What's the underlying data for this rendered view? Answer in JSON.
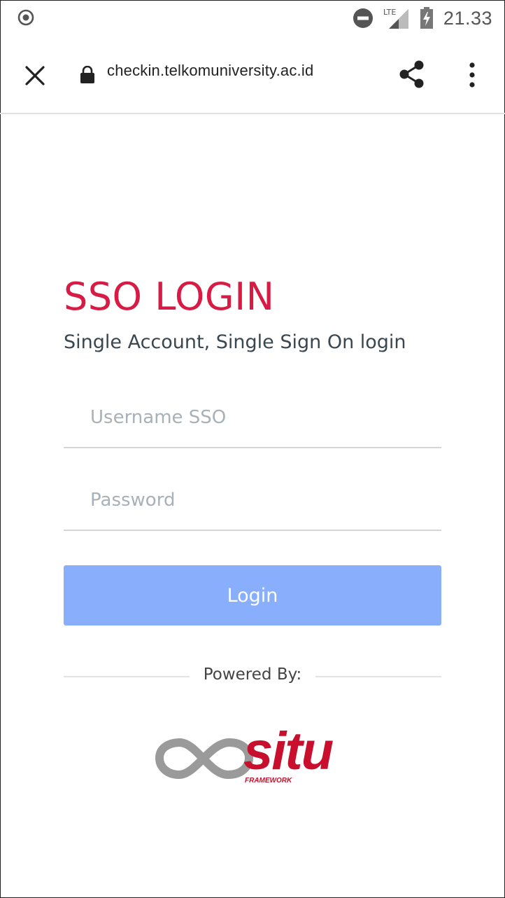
{
  "status_bar": {
    "time": "21.33",
    "network_label": "LTE",
    "icons": [
      "record-icon",
      "do-not-disturb-icon",
      "signal-icon",
      "battery-charging-icon"
    ]
  },
  "browser": {
    "url": "checkin.telkomuniversity.ac.id",
    "icons": [
      "close-icon",
      "lock-icon",
      "share-icon",
      "more-vert-icon"
    ]
  },
  "login": {
    "title": "SSO LOGIN",
    "subtitle": "Single Account, Single Sign On login",
    "username_placeholder": "Username SSO",
    "password_placeholder": "Password",
    "login_label": "Login",
    "powered_by": "Powered By:"
  },
  "logo": {
    "brand": "situ",
    "tagline": "FRAMEWORK"
  },
  "colors": {
    "title": "#d81b44",
    "button": "#88aefc",
    "brand_red": "#c8102e",
    "brand_gray": "#9a9a9a"
  }
}
